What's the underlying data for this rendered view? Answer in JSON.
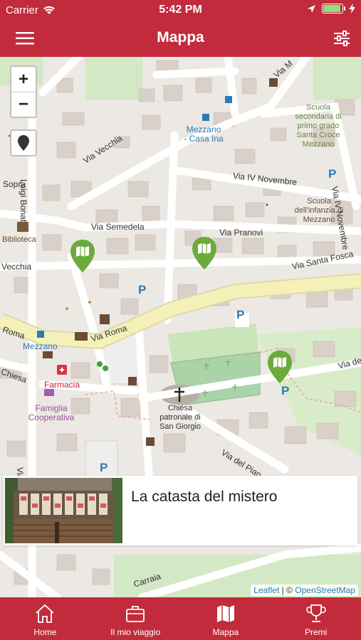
{
  "status_bar": {
    "carrier": "Carrier",
    "time": "5:42 PM"
  },
  "navbar": {
    "title": "Mappa"
  },
  "map": {
    "zoom_in": "+",
    "zoom_out": "−",
    "street_labels": {
      "via_vecchia": "Via Vecchia",
      "luigi_bonat": "Luigi Bonat",
      "via_iv_novembre": "Via IV Novembre",
      "via_iv_novembre_2": "Via IV Novembre",
      "sopra": "Sopra",
      "via_semedela": "Via Semedela",
      "via_pranovi": "Via Pranovi",
      "via_santa_fosca": "Via Santa Fosca",
      "vecchia": "Vecchia",
      "roma": "Roma",
      "via_roma": "Via Roma",
      "chiesa": "Chiesa",
      "via_del_pian": "Via del Pian",
      "via_de": "Via de",
      "carraia": "Carraia",
      "via_top": "Via M",
      "via_v": "V",
      "via_bottom": "Via"
    },
    "place_labels": {
      "mezzano_casa_ina": "Mezzano - Casa Ina",
      "scuola_secondaria": "Scuola secondaria di primo grado Santa Croce Mezzano",
      "scuola_infanzia": "Scuola dell'infanzia di Mezzano",
      "biblioteca": "Biblioteca",
      "mezzano": "Mezzano",
      "farmacia": "Farmacia",
      "famiglia_cooperativa": "Famiglia Cooperativa",
      "chiesa_san_giorgio": "Chiesa patronale di San Giorgio",
      "parking": "P"
    },
    "attribution": {
      "leaflet": "Leaflet",
      "separator": " | © ",
      "osm": "OpenStreetMap"
    }
  },
  "poi_card": {
    "title": "La catasta del mistero"
  },
  "tabs": [
    {
      "label": "Home",
      "icon": "home-icon"
    },
    {
      "label": "Il mio viaggio",
      "icon": "suitcase-icon"
    },
    {
      "label": "Mappa",
      "icon": "map-icon"
    },
    {
      "label": "Premi",
      "icon": "trophy-icon"
    }
  ],
  "colors": {
    "brand": "#c22b3c",
    "map_bg": "#ece8e3",
    "main_road": "#f4f1b8",
    "marker_green": "#6aab3c",
    "park_green": "#c8e6b7"
  }
}
